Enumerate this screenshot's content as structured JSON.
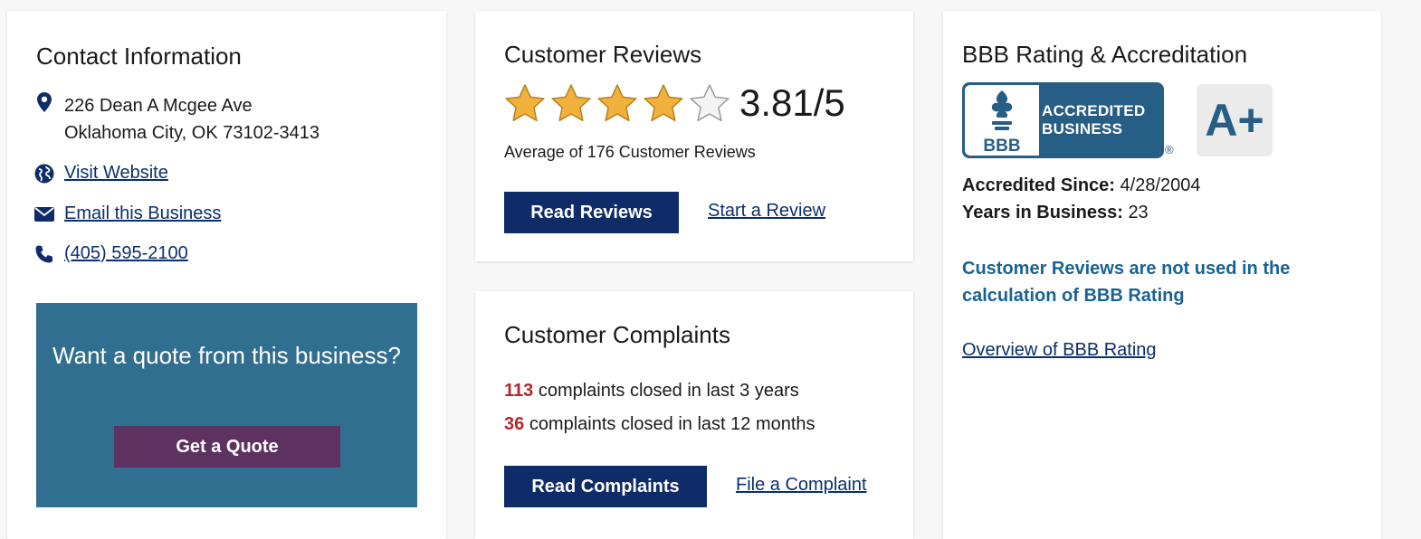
{
  "contact": {
    "title": "Contact Information",
    "address_line1": "226 Dean A Mcgee Ave",
    "address_line2": "Oklahoma City, OK 73102-3413",
    "website_label": "Visit Website",
    "email_label": "Email this Business",
    "phone_label": "(405) 595-2100",
    "quote_prompt": "Want a quote from this business?",
    "quote_button": "Get a Quote"
  },
  "reviews": {
    "title": "Customer Reviews",
    "rating_value": 3.81,
    "score_label": "3.81/5",
    "average_text": "Average of 176 Customer Reviews",
    "read_button": "Read Reviews",
    "start_link": "Start a Review"
  },
  "complaints": {
    "title": "Customer Complaints",
    "closed_3yr_count": "113",
    "closed_3yr_text": "complaints closed in last 3 years",
    "closed_12mo_count": "36",
    "closed_12mo_text": "complaints closed in last 12 months",
    "read_button": "Read Complaints",
    "file_link": "File a Complaint"
  },
  "rating": {
    "title": "BBB Rating & Accreditation",
    "seal_line1": "ACCREDITED",
    "seal_line2": "BUSINESS",
    "seal_logo_text": "BBB",
    "registered_mark": "®",
    "grade": "A+",
    "accredited_since_label": "Accredited Since:",
    "accredited_since_value": "4/28/2004",
    "years_label": "Years in Business:",
    "years_value": "23",
    "note": "Customer Reviews are not used in the calculation of BBB Rating",
    "overview_link": "Overview of BBB Rating"
  },
  "colors": {
    "navy": "#0f2c69",
    "teal_box": "#316f91",
    "plum": "#5d3260",
    "bbb_blue": "#265e85",
    "star_gold": "#f0b23c",
    "complaint_red": "#b4262c"
  }
}
